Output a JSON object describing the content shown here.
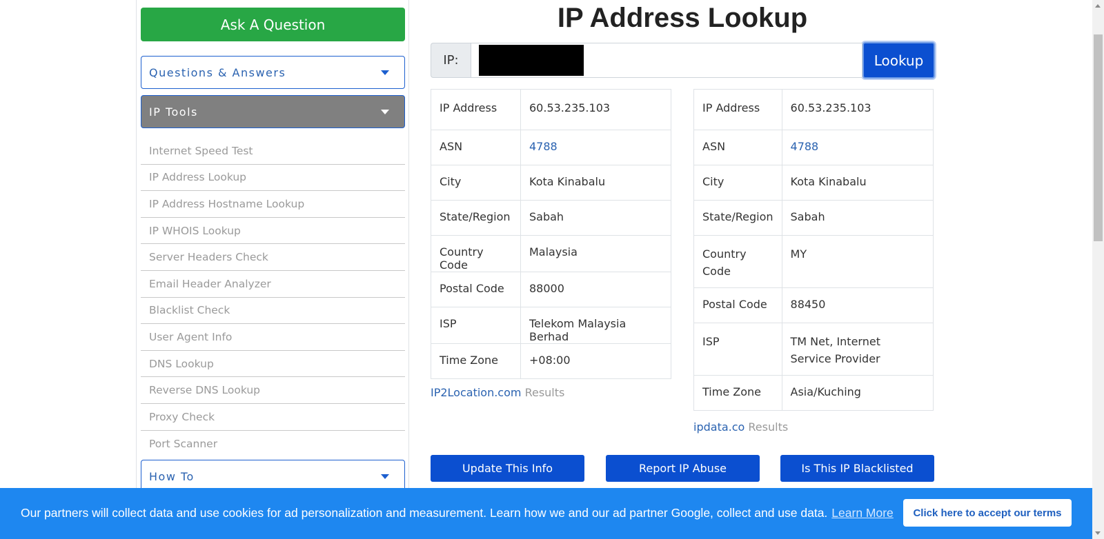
{
  "sidebar": {
    "ask_button": "Ask A Question",
    "sections": {
      "qa": "Questions & Answers",
      "tools": "IP Tools",
      "howto": "How To"
    },
    "tools": [
      "Internet Speed Test",
      "IP Address Lookup",
      "IP Address Hostname Lookup",
      "IP WHOIS Lookup",
      "Server Headers Check",
      "Email Header Analyzer",
      "Blacklist Check",
      "User Agent Info",
      "DNS Lookup",
      "Reverse DNS Lookup",
      "Proxy Check",
      "Port Scanner"
    ]
  },
  "main": {
    "title": "IP Address Lookup",
    "ip_label": "IP:",
    "lookup_button": "Lookup",
    "table1": {
      "rows": [
        {
          "label": "IP Address",
          "value": "60.53.235.103"
        },
        {
          "label": "ASN",
          "value": "4788"
        },
        {
          "label": "City",
          "value": "Kota Kinabalu"
        },
        {
          "label": "State/Region",
          "value": "Sabah"
        },
        {
          "label": "Country Code",
          "value": "Malaysia"
        },
        {
          "label": "Postal Code",
          "value": "88000"
        },
        {
          "label": "ISP",
          "value": "Telekom Malaysia Berhad"
        },
        {
          "label": "Time Zone",
          "value": "+08:00"
        }
      ],
      "source_link": "IP2Location.com",
      "source_suffix": "Results"
    },
    "table2": {
      "rows": [
        {
          "label": "IP Address",
          "value": "60.53.235.103"
        },
        {
          "label": "ASN",
          "value": "4788"
        },
        {
          "label": "City",
          "value": "Kota Kinabalu"
        },
        {
          "label": "State/Region",
          "value": "Sabah"
        },
        {
          "label": "Country Code",
          "value": "MY"
        },
        {
          "label": "Postal Code",
          "value": "88450"
        },
        {
          "label": "ISP",
          "value": "TM Net, Internet Service Provider"
        },
        {
          "label": "Time Zone",
          "value": "Asia/Kuching"
        }
      ],
      "source_link": "ipdata.co",
      "source_suffix": "Results"
    },
    "actions": {
      "update": "Update This Info",
      "report": "Report IP Abuse",
      "blacklisted": "Is This IP Blacklisted"
    }
  },
  "cookie_banner": {
    "message": "Our partners will collect data and use cookies for ad personalization and measurement. Learn how we and our ad partner Google, collect and use data.",
    "learn_more": "Learn More",
    "accept_button": "Click here to accept our terms"
  },
  "colors": {
    "ask_green": "#28a745",
    "primary_blue": "#0b4fd0",
    "link_blue": "#2a62b0",
    "banner_blue": "#1e87f0",
    "accordion_gray": "#808080"
  }
}
